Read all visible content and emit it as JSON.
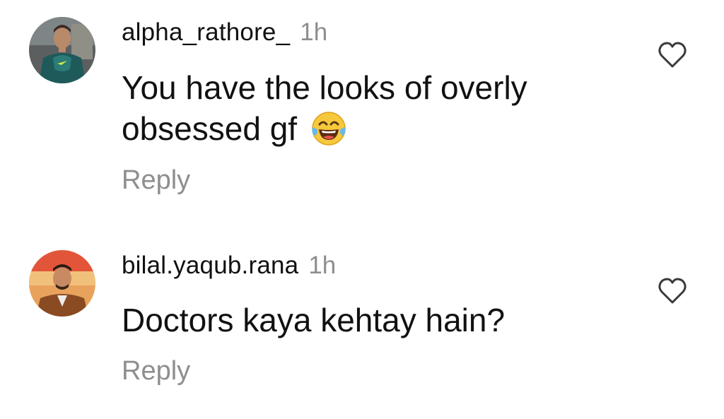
{
  "comments": [
    {
      "username": "alpha_rathore_",
      "time": "1h",
      "text": "You have the looks of overly obsessed gf",
      "emoji": "face-with-tears-of-joy-icon",
      "reply_label": "Reply",
      "like_icon": "heart-outline-icon"
    },
    {
      "username": "bilal.yaqub.rana",
      "time": "1h",
      "text": "Doctors kaya kehtay hain?",
      "reply_label": "Reply",
      "like_icon": "heart-outline-icon"
    }
  ],
  "colors": {
    "text_primary": "#111111",
    "text_secondary": "#8e8e8e",
    "background": "#ffffff"
  }
}
